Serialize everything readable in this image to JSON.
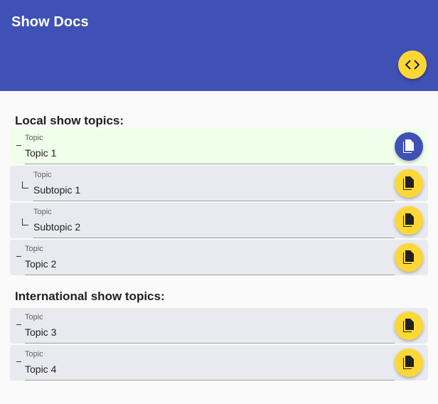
{
  "app": {
    "title": "Show Docs",
    "primary_color": "#3f51b5",
    "accent_color": "#fdd835",
    "fab_icon": "code-icon"
  },
  "local": {
    "heading": "Local show topics:",
    "topics": [
      {
        "label": "Topic",
        "value": "Topic 1",
        "level": 0,
        "active": true
      },
      {
        "label": "Topic",
        "value": "Subtopic 1",
        "level": 1,
        "active": false
      },
      {
        "label": "Topic",
        "value": "Subtopic 2",
        "level": 1,
        "active": false
      },
      {
        "label": "Topic",
        "value": "Topic 2",
        "level": 0,
        "active": false
      }
    ]
  },
  "international": {
    "heading": "International show topics:",
    "topics": [
      {
        "label": "Topic",
        "value": "Topic 3",
        "level": 0,
        "active": false
      },
      {
        "label": "Topic",
        "value": "Topic 4",
        "level": 0,
        "active": false
      }
    ]
  },
  "icons": {
    "copy": "content-copy-icon"
  }
}
